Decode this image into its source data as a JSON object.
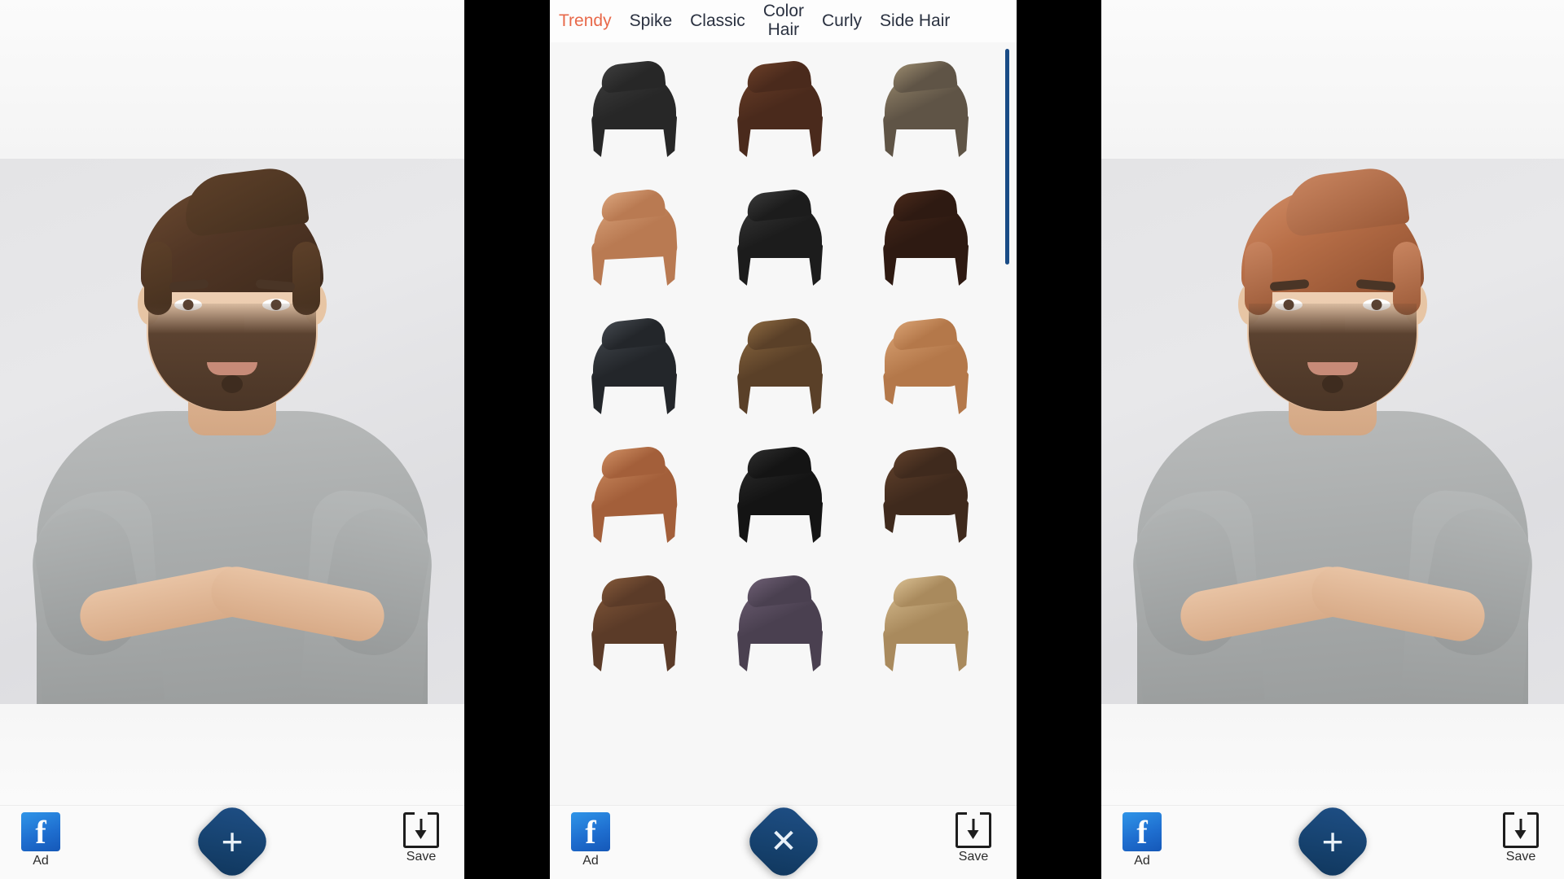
{
  "app": {
    "background_color": "#000000",
    "panel_count": 3
  },
  "left_panel": {
    "name": "before-preview",
    "photo": {
      "subject": "bearded-man-arms-crossed",
      "hair_color": "#4f3727",
      "hair_style": "original-brown-quiff",
      "shirt_color": "#a9acac",
      "backdrop_color": "#e4e4e6"
    },
    "bottom_bar": {
      "ad_label": "Ad",
      "ad_icon": "facebook-icon",
      "fab_icon": "plus-icon",
      "fab_color": "#16426f",
      "save_label": "Save",
      "save_icon": "download-icon"
    }
  },
  "center_panel": {
    "name": "hairstyle-picker",
    "tabs": [
      {
        "label": "Trendy",
        "active": true
      },
      {
        "label": "Spike",
        "active": false
      },
      {
        "label": "Color\nHair",
        "active": false
      },
      {
        "label": "Classic",
        "active": false
      },
      {
        "label": "Curly",
        "active": false
      },
      {
        "label": "Side Hair",
        "active": false
      }
    ],
    "tab_order": [
      "Trendy",
      "Spike",
      "Classic",
      "Color Hair",
      "Curly",
      "Side Hair"
    ],
    "active_tab": "Trendy",
    "active_tab_color": "#e8694a",
    "inactive_tab_color": "#2a3140",
    "scrollbar": {
      "color": "#1a4c86",
      "position": "top",
      "visible": true
    },
    "grid": {
      "columns": 3,
      "items": [
        {
          "name": "hairstyle-1",
          "style": "flat-fringe",
          "color": "#272727",
          "tone2": "#3e3e3e"
        },
        {
          "name": "hairstyle-2",
          "style": "messy-swept",
          "color": "#4a2a1c",
          "tone2": "#6b3f28"
        },
        {
          "name": "hairstyle-3",
          "style": "short-combed",
          "color": "#5f5446",
          "tone2": "#9a8a6e"
        },
        {
          "name": "hairstyle-4",
          "style": "side-sweep",
          "color": "#b97a52",
          "tone2": "#dba57d"
        },
        {
          "name": "hairstyle-5",
          "style": "textured-crop",
          "color": "#1c1c1c",
          "tone2": "#3a3a3a"
        },
        {
          "name": "hairstyle-6",
          "style": "slick-back",
          "color": "#2e1a12",
          "tone2": "#4a2a1b"
        },
        {
          "name": "hairstyle-7",
          "style": "glossy-pomp",
          "color": "#23262a",
          "tone2": "#454a50"
        },
        {
          "name": "hairstyle-8",
          "style": "brown-quiff",
          "color": "#5a4028",
          "tone2": "#8d6a41"
        },
        {
          "name": "hairstyle-9",
          "style": "curly-top",
          "color": "#b4784a",
          "tone2": "#d9a273"
        },
        {
          "name": "hairstyle-10",
          "style": "copper-sweep",
          "color": "#a35f3a",
          "tone2": "#cf8f63"
        },
        {
          "name": "hairstyle-11",
          "style": "spiky-black",
          "color": "#141414",
          "tone2": "#2e2e2e"
        },
        {
          "name": "hairstyle-12",
          "style": "curly-brown",
          "color": "#3f2a1d",
          "tone2": "#63422c"
        },
        {
          "name": "hairstyle-13",
          "style": "brown-wave",
          "color": "#5b3b28",
          "tone2": "#84593a"
        },
        {
          "name": "hairstyle-14",
          "style": "ash-purple",
          "color": "#4a4050",
          "tone2": "#6e5f74"
        },
        {
          "name": "hairstyle-15",
          "style": "blonde-wave",
          "color": "#a98a5d",
          "tone2": "#d9bf92"
        }
      ]
    },
    "bottom_bar": {
      "ad_label": "Ad",
      "ad_icon": "facebook-icon",
      "fab_icon": "close-icon",
      "fab_color": "#16426f",
      "save_label": "Save",
      "save_icon": "download-icon"
    }
  },
  "right_panel": {
    "name": "after-preview",
    "photo": {
      "subject": "bearded-man-arms-crossed",
      "hair_color": "#b86f48",
      "hair_style": "copper-side-sweep",
      "shirt_color": "#a9acac",
      "backdrop_color": "#e4e4e6"
    },
    "bottom_bar": {
      "ad_label": "Ad",
      "ad_icon": "facebook-icon",
      "fab_icon": "plus-icon",
      "fab_color": "#16426f",
      "save_label": "Save",
      "save_icon": "download-icon"
    }
  }
}
